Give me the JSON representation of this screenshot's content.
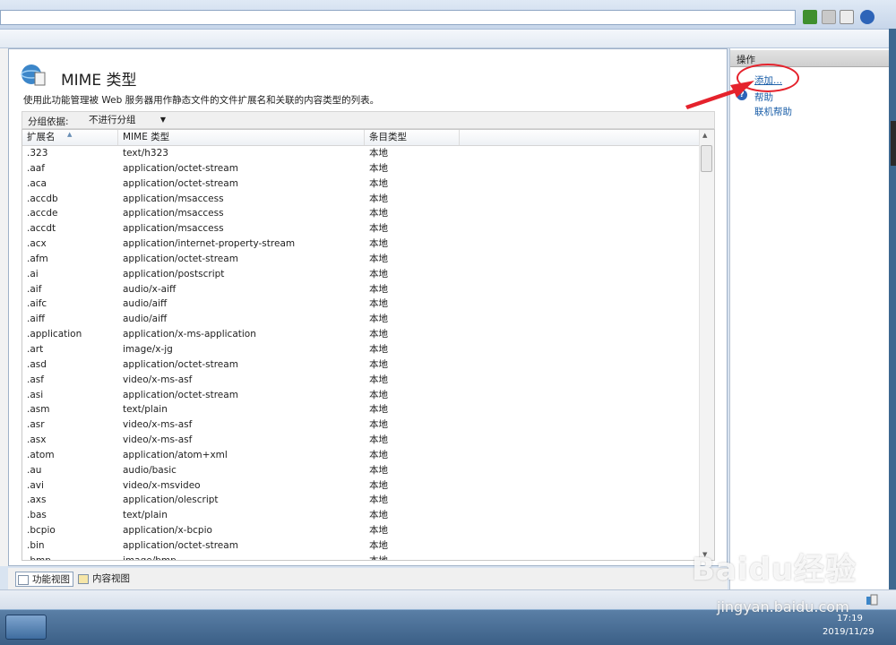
{
  "content": {
    "title": "MIME 类型",
    "description": "使用此功能管理被 Web 服务器用作静态文件的文件扩展名和关联的内容类型的列表。",
    "group_label": "分组依据:",
    "group_value": "不进行分组",
    "columns": [
      "扩展名",
      "MIME 类型",
      "条目类型"
    ],
    "rows": [
      [
        ".323",
        "text/h323",
        "本地"
      ],
      [
        ".aaf",
        "application/octet-stream",
        "本地"
      ],
      [
        ".aca",
        "application/octet-stream",
        "本地"
      ],
      [
        ".accdb",
        "application/msaccess",
        "本地"
      ],
      [
        ".accde",
        "application/msaccess",
        "本地"
      ],
      [
        ".accdt",
        "application/msaccess",
        "本地"
      ],
      [
        ".acx",
        "application/internet-property-stream",
        "本地"
      ],
      [
        ".afm",
        "application/octet-stream",
        "本地"
      ],
      [
        ".ai",
        "application/postscript",
        "本地"
      ],
      [
        ".aif",
        "audio/x-aiff",
        "本地"
      ],
      [
        ".aifc",
        "audio/aiff",
        "本地"
      ],
      [
        ".aiff",
        "audio/aiff",
        "本地"
      ],
      [
        ".application",
        "application/x-ms-application",
        "本地"
      ],
      [
        ".art",
        "image/x-jg",
        "本地"
      ],
      [
        ".asd",
        "application/octet-stream",
        "本地"
      ],
      [
        ".asf",
        "video/x-ms-asf",
        "本地"
      ],
      [
        ".asi",
        "application/octet-stream",
        "本地"
      ],
      [
        ".asm",
        "text/plain",
        "本地"
      ],
      [
        ".asr",
        "video/x-ms-asf",
        "本地"
      ],
      [
        ".asx",
        "video/x-ms-asf",
        "本地"
      ],
      [
        ".atom",
        "application/atom+xml",
        "本地"
      ],
      [
        ".au",
        "audio/basic",
        "本地"
      ],
      [
        ".avi",
        "video/x-msvideo",
        "本地"
      ],
      [
        ".axs",
        "application/olescript",
        "本地"
      ],
      [
        ".bas",
        "text/plain",
        "本地"
      ],
      [
        ".bcpio",
        "application/x-bcpio",
        "本地"
      ],
      [
        ".bin",
        "application/octet-stream",
        "本地"
      ],
      [
        ".bmp",
        "image/bmp",
        "本地"
      ]
    ]
  },
  "view_tabs": [
    "功能视图",
    "内容视图"
  ],
  "actions": {
    "title": "操作",
    "add": "添加...",
    "help": "帮助",
    "online_help": "联机帮助"
  },
  "taskbar": {
    "time": "17:19",
    "date": "2019/11/29"
  },
  "watermark": {
    "brand": "Baidu经验",
    "url": "jingyan.baidu.com"
  },
  "colors": {
    "link": "#1a5ea8",
    "annotation": "#e5222c",
    "taskbar": "#3b5f86"
  },
  "icons": [
    "iis-mime-icon",
    "help-icon",
    "features-view-icon",
    "content-view-icon",
    "start-icon",
    "sort-ascending-icon"
  ]
}
